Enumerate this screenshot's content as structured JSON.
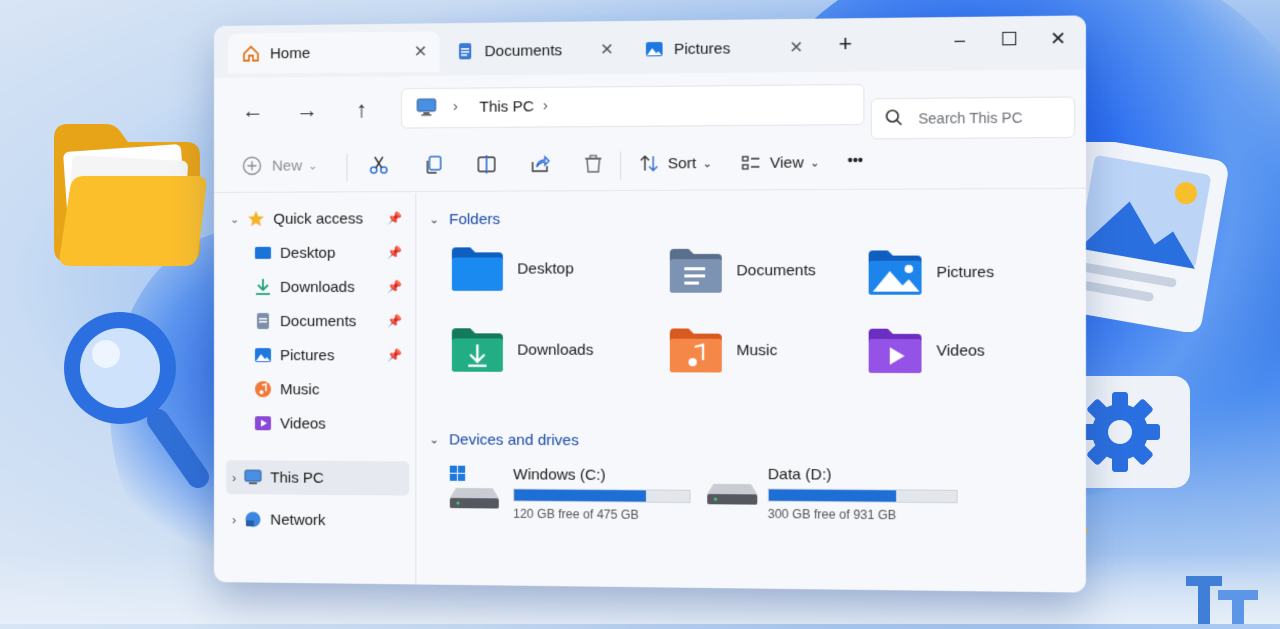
{
  "tabs": [
    {
      "label": "Home",
      "icon": "home-icon"
    },
    {
      "label": "Documents",
      "icon": "document-icon"
    },
    {
      "label": "Pictures",
      "icon": "picture-icon"
    }
  ],
  "window_controls": {
    "minimize": "–",
    "maximize": "☐",
    "close": "✕",
    "new_tab": "+"
  },
  "address": {
    "location": "This PC"
  },
  "search": {
    "placeholder": "Search This PC"
  },
  "commands": {
    "new_label": "New",
    "sort_label": "Sort",
    "view_label": "View",
    "more_label": "•••"
  },
  "sidebar": {
    "quick_access": "Quick access",
    "items": [
      {
        "label": "Desktop"
      },
      {
        "label": "Downloads"
      },
      {
        "label": "Documents"
      },
      {
        "label": "Pictures"
      },
      {
        "label": "Music"
      },
      {
        "label": "Videos"
      }
    ],
    "this_pc": "This PC",
    "network": "Network"
  },
  "main": {
    "folders_heading": "Folders",
    "folders": [
      {
        "label": "Desktop",
        "color": "#1a73d9"
      },
      {
        "label": "Documents",
        "color": "#6f86a6"
      },
      {
        "label": "Pictures",
        "color": "#1d78e0"
      },
      {
        "label": "Downloads",
        "color": "#1e9e78"
      },
      {
        "label": "Music",
        "color": "#f07a3a"
      },
      {
        "label": "Videos",
        "color": "#8a4ad8"
      }
    ],
    "drives_heading": "Devices and drives",
    "drives": [
      {
        "label": "Windows (C:)",
        "free_text": "120 GB free of 475 GB",
        "used_fraction": 0.75
      },
      {
        "label": "Data (D:)",
        "free_text": "300 GB free of 931 GB",
        "used_fraction": 0.68
      }
    ]
  },
  "colors": {
    "accent": "#1d6fd6",
    "heading": "#1a4aa8"
  }
}
